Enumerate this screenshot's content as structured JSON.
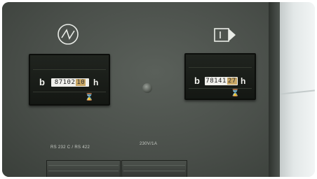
{
  "panel": {
    "colors": {
      "panel": "#4a4f4a",
      "meter": "#1a1d19",
      "label": "#c8ccc6",
      "wall": "#e3e8e8"
    },
    "icons": [
      "ac-symbol-icon",
      "output-port-icon"
    ],
    "left_meter": {
      "digits": "87102",
      "decimal": "10",
      "unit": "h",
      "symbol": "b"
    },
    "right_meter": {
      "digits": "78141",
      "decimal": "27",
      "unit": "h",
      "symbol": "b"
    },
    "labels": {
      "rs": "RS 232 C / RS 422",
      "voltage": "230V/1A"
    }
  }
}
